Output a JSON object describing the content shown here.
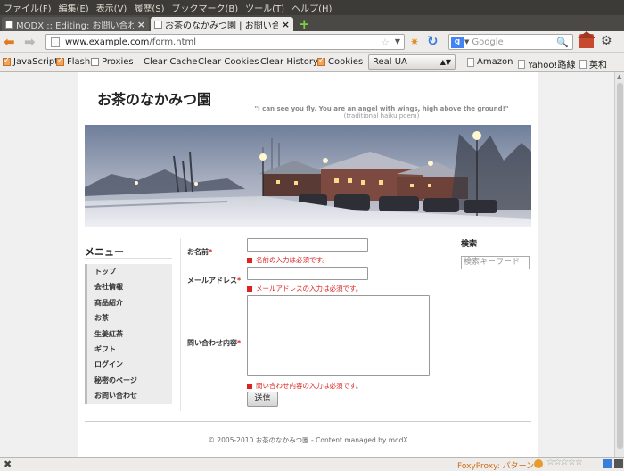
{
  "menubar": {
    "items": [
      "ファイル(F)",
      "編集(E)",
      "表示(V)",
      "履歴(S)",
      "ブックマーク(B)",
      "ツール(T)",
      "ヘルプ(H)"
    ]
  },
  "tabs": [
    {
      "label": "MODX :: Editing: お問い合わせ"
    },
    {
      "label": "お茶のなかみつ園 | お問い合..."
    }
  ],
  "nav": {
    "url_domain": "www.example.com",
    "url_path": "/form.html",
    "search_placeholder": "Google"
  },
  "toolbar": {
    "checkboxes": [
      {
        "label": "JavaScript",
        "checked": true
      },
      {
        "label": "Flash",
        "checked": true
      },
      {
        "label": "Proxies",
        "checked": false
      }
    ],
    "buttons": [
      "Clear Cache",
      "Clear Cookies",
      "Clear History"
    ],
    "cookies": {
      "label": "Cookies",
      "checked": true
    },
    "ua_select": "Real UA",
    "bookmarks": [
      "Amazon",
      "Yahoo!路線",
      "英和"
    ]
  },
  "site": {
    "title": "お茶のなかみつ園",
    "tagline": "\"I can see you fly. You are an angel with wings, high above the ground!\"",
    "tagline_sub": "(traditional haiku poem)"
  },
  "sidebar": {
    "heading": "メニュー",
    "items": [
      "トップ",
      "会社情報",
      "商品紹介",
      "お茶",
      "生姜紅茶",
      "ギフト",
      "ログイン",
      "秘密のページ",
      "お問い合わせ"
    ]
  },
  "form": {
    "name_label": "お名前",
    "name_error": "名前の入力は必須です。",
    "email_label": "メールアドレス",
    "email_error": "メールアドレスの入力は必須です。",
    "message_label": "問い合わせ内容",
    "message_error": "問い合わせ内容の入力は必須です。",
    "required_mark": "*",
    "submit_label": "送信"
  },
  "search": {
    "heading": "検索",
    "placeholder": "検索キーワード"
  },
  "footer": {
    "text": "© 2005-2010 お茶のなかみつ園 - Content managed by modX"
  },
  "statusbar": {
    "foxyproxy": "FoxyProxy: パターン"
  },
  "colors": {
    "error": "#dd2222",
    "chrome": "#edeceb",
    "menubar": "#3c3b37"
  }
}
